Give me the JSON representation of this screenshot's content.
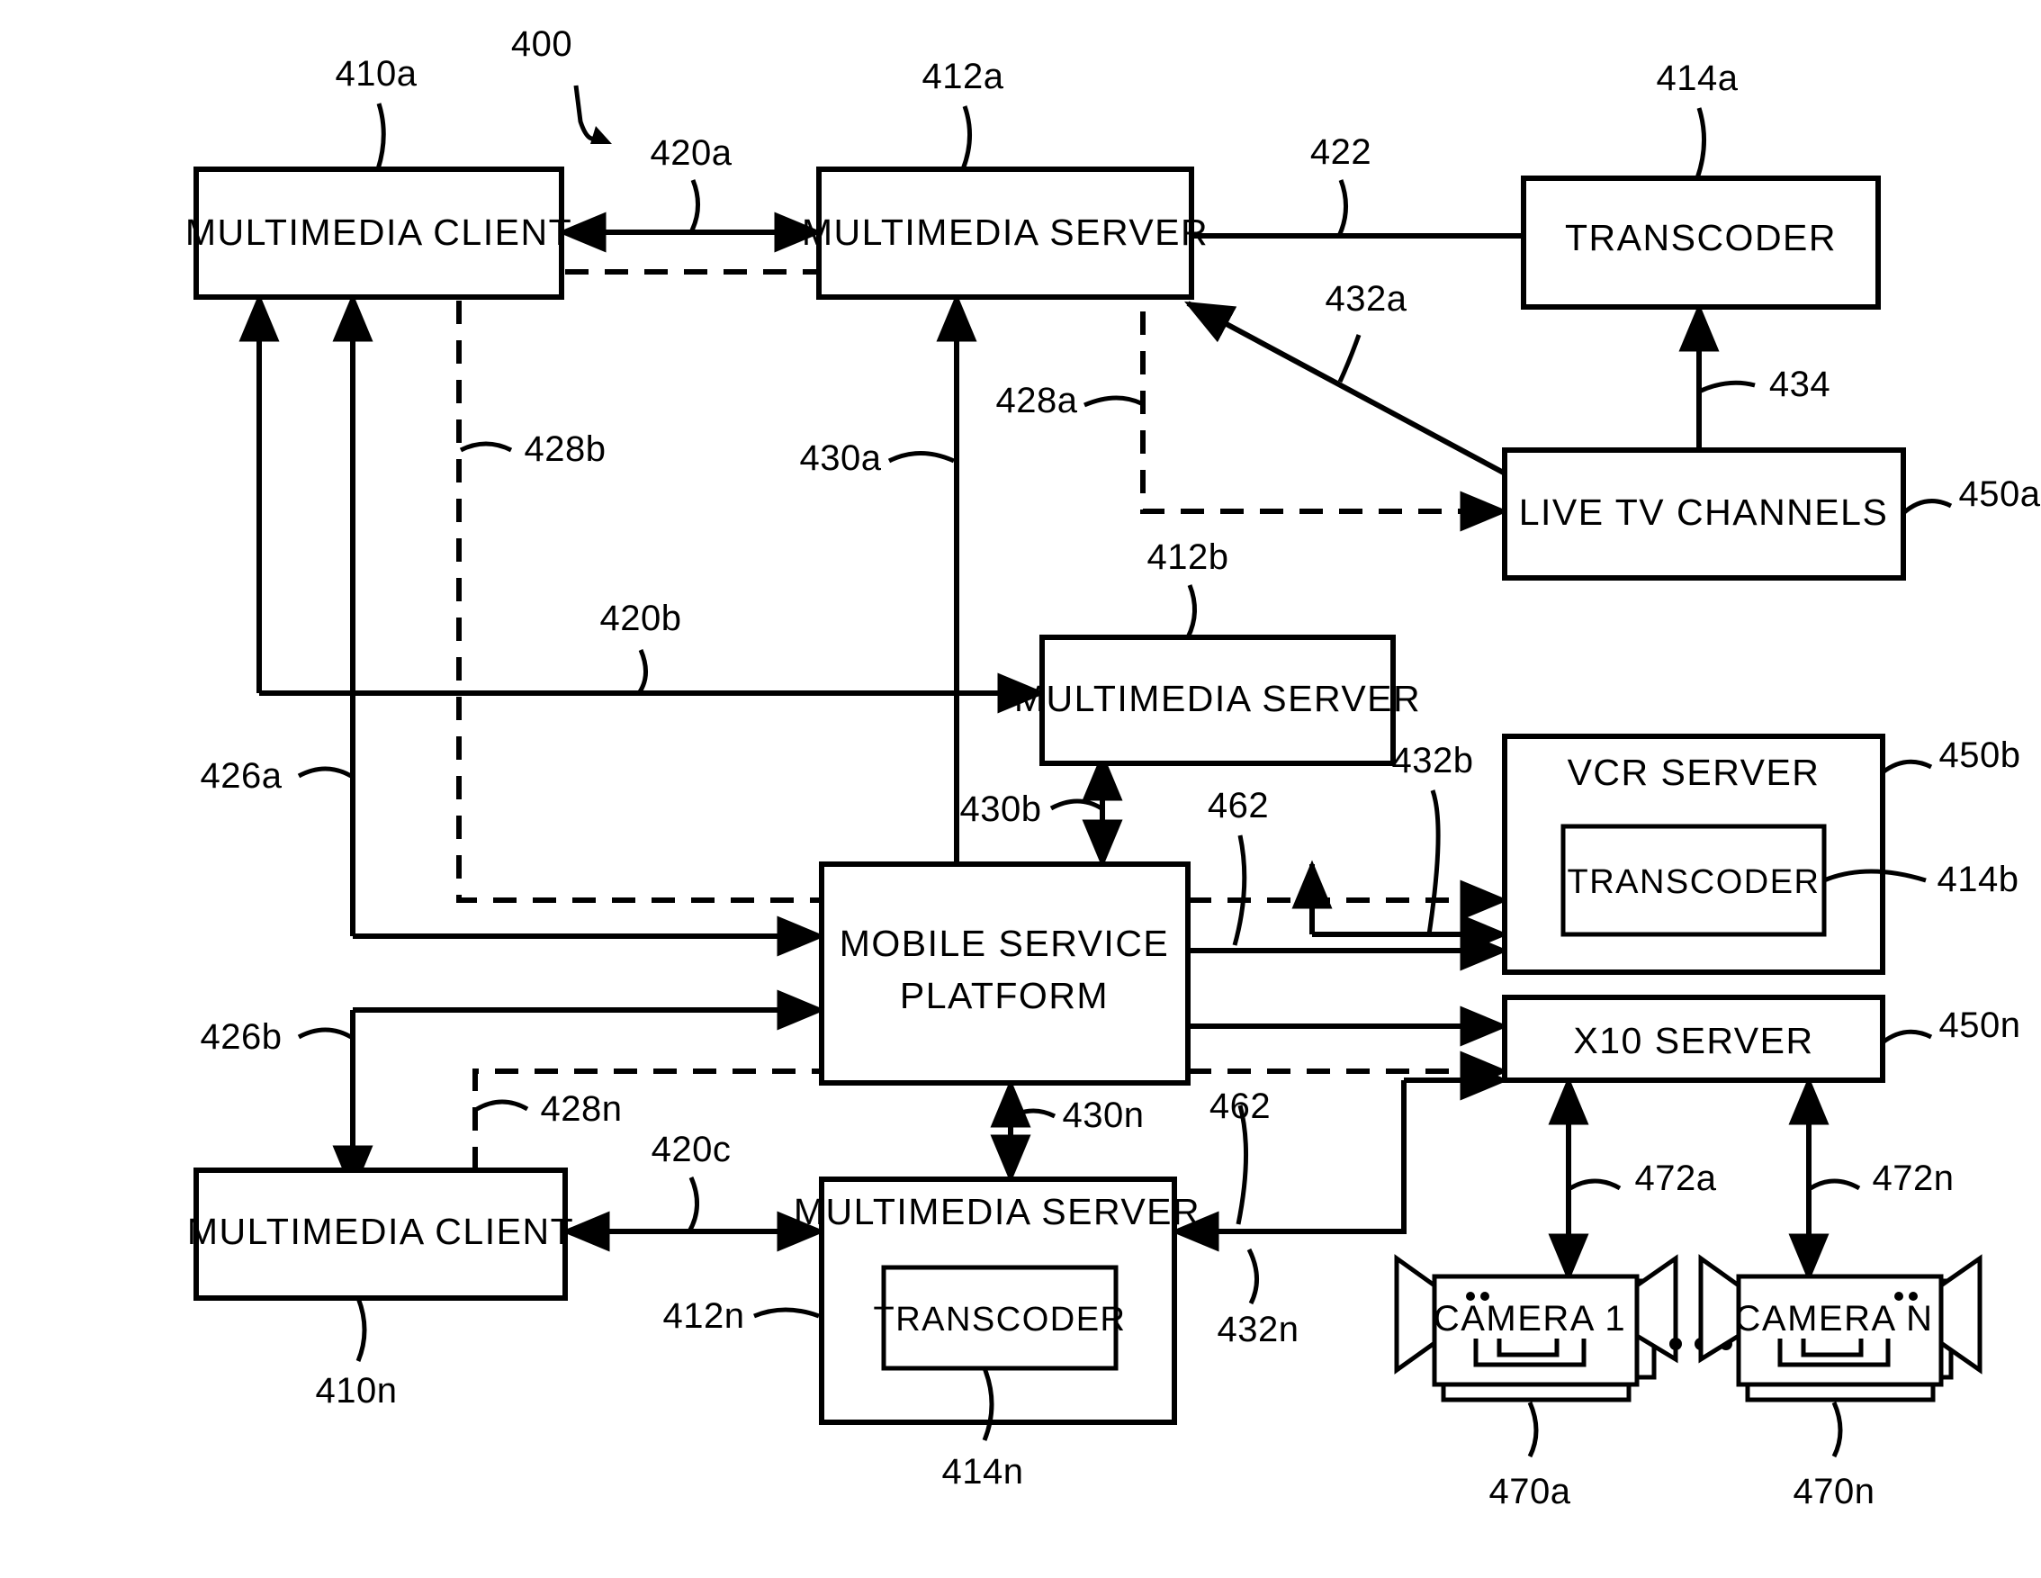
{
  "figure": {
    "number": "400",
    "title": "Multimedia distribution system block diagram"
  },
  "boxes": {
    "client_a": {
      "label": "MULTIMEDIA CLIENT",
      "ref": "410a"
    },
    "client_n": {
      "label": "MULTIMEDIA CLIENT",
      "ref": "410n"
    },
    "server_a": {
      "label": "MULTIMEDIA SERVER",
      "ref": "412a"
    },
    "server_b": {
      "label": "MULTIMEDIA SERVER",
      "ref": "412b"
    },
    "server_n": {
      "label": "MULTIMEDIA SERVER",
      "ref": "412n"
    },
    "transcoder_a": {
      "label": "TRANSCODER",
      "ref": "414a"
    },
    "transcoder_b": {
      "label": "TRANSCODER",
      "ref": "414b"
    },
    "transcoder_n": {
      "label": "TRANSCODER",
      "ref": "414n"
    },
    "live_tv": {
      "label": "LIVE TV CHANNELS",
      "ref": "450a"
    },
    "vcr_server": {
      "label": "VCR SERVER",
      "ref": "450b"
    },
    "x10_server": {
      "label": "X10 SERVER",
      "ref": "450n"
    },
    "msp": {
      "label_line1": "MOBILE SERVICE",
      "label_line2": "PLATFORM"
    },
    "camera_1": {
      "label": "CAMERA 1",
      "ref": "470a"
    },
    "camera_n": {
      "label": "CAMERA N",
      "ref": "470n"
    },
    "ellipsis": "• • •"
  },
  "connectors": [
    {
      "ref": "420a",
      "kind": "solid-bidirectional"
    },
    {
      "ref": "420b",
      "kind": "solid-arrow"
    },
    {
      "ref": "420c",
      "kind": "solid-bidirectional"
    },
    {
      "ref": "422",
      "kind": "solid-arrow"
    },
    {
      "ref": "426a",
      "kind": "solid-arrow"
    },
    {
      "ref": "426b",
      "kind": "solid-arrow"
    },
    {
      "ref": "428a",
      "kind": "dashed"
    },
    {
      "ref": "428b",
      "kind": "dashed"
    },
    {
      "ref": "428n",
      "kind": "dashed"
    },
    {
      "ref": "430a",
      "kind": "solid-arrow"
    },
    {
      "ref": "430b",
      "kind": "solid-bidirectional"
    },
    {
      "ref": "430n",
      "kind": "solid-bidirectional"
    },
    {
      "ref": "432a",
      "kind": "solid-arrow"
    },
    {
      "ref": "432b",
      "kind": "solid-arrow"
    },
    {
      "ref": "432n",
      "kind": "solid-arrow"
    },
    {
      "ref": "434",
      "kind": "solid-arrow"
    },
    {
      "ref": "462",
      "kind": "solid-arrow"
    },
    {
      "ref": "472a",
      "kind": "solid-bidirectional"
    },
    {
      "ref": "472n",
      "kind": "solid-bidirectional"
    }
  ],
  "ref_labels": {
    "fig400": "400",
    "r410a": "410a",
    "r410n": "410n",
    "r412a": "412a",
    "r412b": "412b",
    "r412n": "412n",
    "r414a": "414a",
    "r414b": "414b",
    "r414n": "414n",
    "r420a": "420a",
    "r420b": "420b",
    "r420c": "420c",
    "r422": "422",
    "r426a": "426a",
    "r426b": "426b",
    "r428a": "428a",
    "r428b": "428b",
    "r428n": "428n",
    "r430a": "430a",
    "r430b": "430b",
    "r430n": "430n",
    "r432a": "432a",
    "r432b": "432b",
    "r432n": "432n",
    "r434": "434",
    "r450a": "450a",
    "r450b": "450b",
    "r450n": "450n",
    "r462a": "462",
    "r462b": "462",
    "r470a": "470a",
    "r470n": "470n",
    "r472a": "472a",
    "r472n": "472n"
  },
  "colors": {
    "ink": "#000000",
    "paper": "#ffffff"
  }
}
